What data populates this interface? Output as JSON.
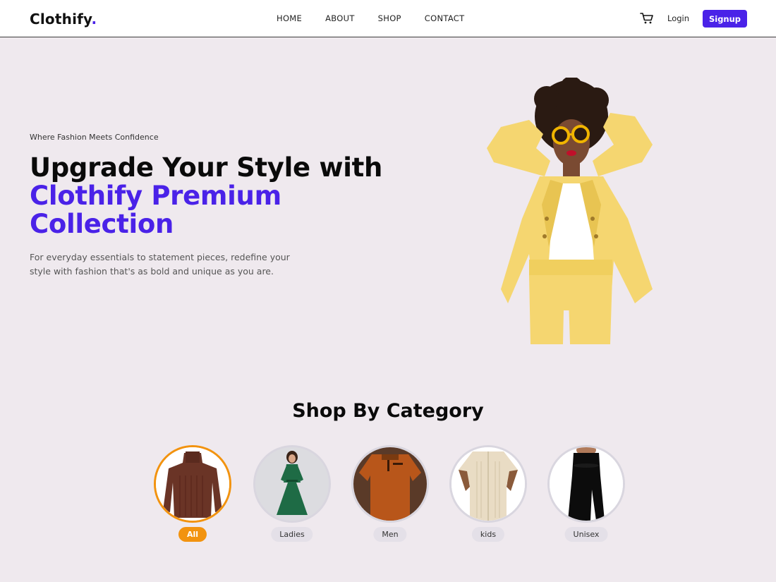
{
  "brand": {
    "name": "Clothify",
    "dot": ".",
    "accent": "#4a22e8"
  },
  "nav": {
    "links": [
      "HOME",
      "ABOUT",
      "SHOP",
      "CONTACT"
    ],
    "login": "Login",
    "signup": "Signup"
  },
  "hero": {
    "tagline": "Where Fashion Meets Confidence",
    "headline_line1": "Upgrade Your Style with",
    "headline_line2": "Clothify Premium",
    "headline_line3": "Collection",
    "description": "For everyday essentials to statement pieces, redefine your style with fashion that's as bold and unique as you are."
  },
  "categories": {
    "title": "Shop By Category",
    "active_color": "#f2930f",
    "items": [
      {
        "label": "All",
        "active": true
      },
      {
        "label": "Ladies",
        "active": false
      },
      {
        "label": "Men",
        "active": false
      },
      {
        "label": "kids",
        "active": false
      },
      {
        "label": "Unisex",
        "active": false
      }
    ]
  }
}
